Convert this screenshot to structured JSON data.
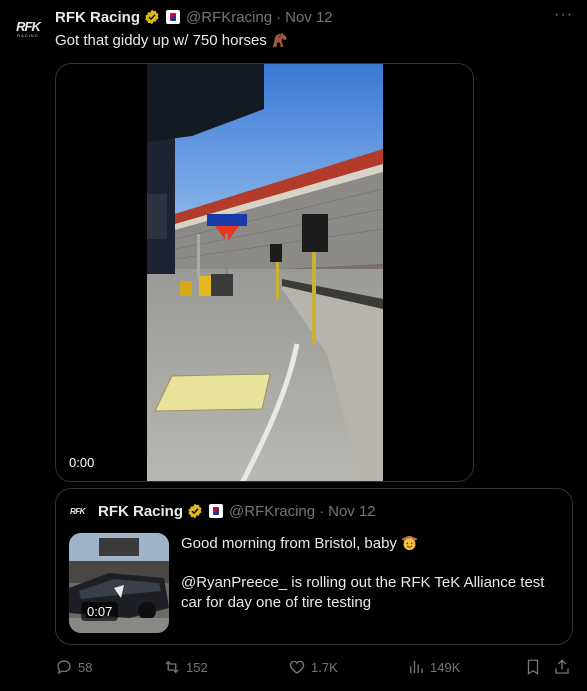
{
  "tweet": {
    "avatar_logo": "RFK",
    "avatar_sub": "RACING",
    "name": "RFK Racing",
    "handle": "@RFKracing",
    "separator": "·",
    "date": "Nov 12",
    "more": "···",
    "text": "Got that giddy up w/ 750 horses"
  },
  "media": {
    "timestamp": "0:00"
  },
  "quote": {
    "avatar_logo": "RFK",
    "name": "RFK Racing",
    "handle": "@RFKracing",
    "separator": "·",
    "date": "Nov 12",
    "line1": "Good morning from Bristol, baby",
    "line2": "@RyanPreece_ is rolling out the RFK TeK Alliance test car for day one of tire testing",
    "video_time": "0:07"
  },
  "actions": {
    "replies": "58",
    "reposts": "152",
    "likes": "1.7K",
    "views": "149K"
  },
  "colors": {
    "background": "#000000",
    "text": "#e7e9ea",
    "muted": "#71767b",
    "border": "#2f3336",
    "verified_gold": "#e2b719"
  }
}
